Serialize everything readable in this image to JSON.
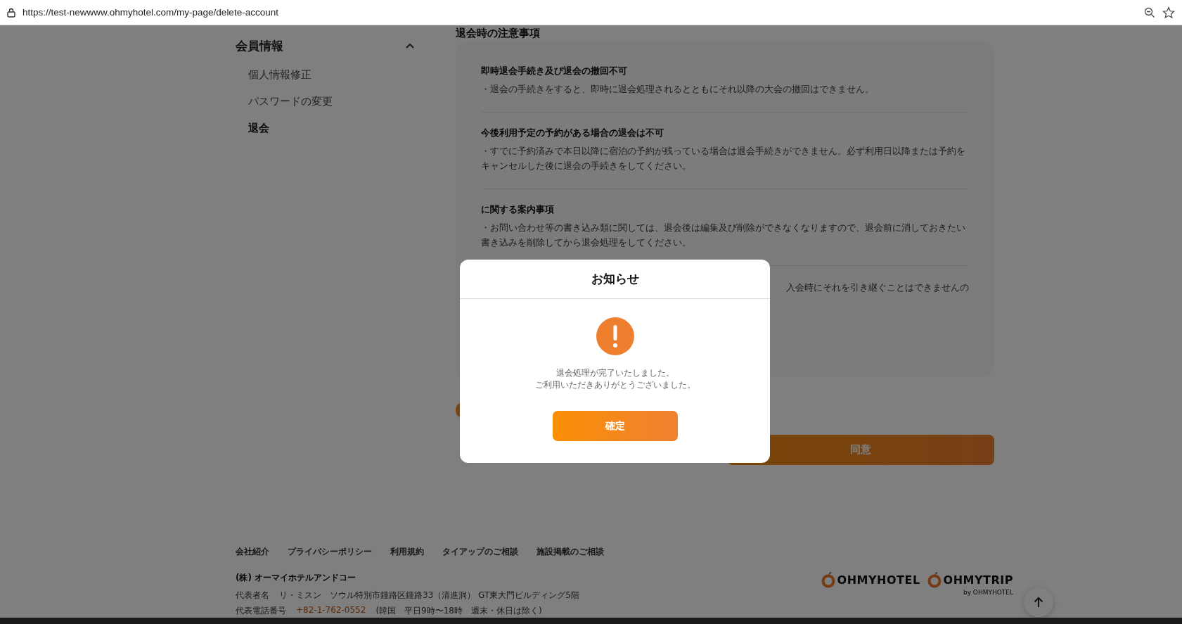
{
  "browser": {
    "url": "https://test-newwww.ohmyhotel.com/my-page/delete-account"
  },
  "sidebar": {
    "title": "会員情報",
    "expanded": true,
    "items": [
      {
        "label": "個人情報修正",
        "selected": false
      },
      {
        "label": "パスワードの変更",
        "selected": false
      },
      {
        "label": "退会",
        "selected": true
      }
    ]
  },
  "section_title": "退会時の注意事項",
  "notices": [
    {
      "title": "即時退会手続き及び退会の撤回不可",
      "body": "・退会の手続きをすると、即時に退会処理されるとともにそれ以降の大会の撤回はできません。"
    },
    {
      "title": "今後利用予定の予約がある場合の退会は不可",
      "body": "・すでに予約済みで本日以降に宿泊の予約が残っている場合は退会手続きができません。必ず利用日以降または予約をキャンセルした後に退会の手続きをしてください。"
    },
    {
      "title": "に関する案内事項",
      "body": "・お問い合わせ等の書き込み類に関しては、退会後は編集及び削除ができなくなりますので、退会前に消しておきたい書き込みを削除してから退会処理をしてください。"
    },
    {
      "body": "入会時にそれを引き継ぐことはできませんの"
    }
  ],
  "agree_button": "同意",
  "footer": {
    "links": [
      "会社紹介",
      "プライバシーポリシー",
      "利用規約",
      "タイアップのご相談",
      "施設掲載のご相談"
    ],
    "company": "(株) オーマイホテルアンドコー",
    "address_label": "代表者名",
    "address": "リ・ミスン　ソウル特別市鍾路区鍾路33（清進洞） GT東大門ビルディング5階",
    "phone_label": "代表電話番号",
    "phone": "+82-1-762-0552",
    "hours": "(韓国　平日9時〜18時　週末・休日は除く)",
    "logos": [
      "OHMYHOTEL",
      "OHMYTRIP"
    ],
    "logo_sub": "by OHMYHOTEL"
  },
  "dialog": {
    "title": "お知らせ",
    "message": [
      "退会処理が完了いたしました。",
      "ご利用いただきありがとうございました。"
    ],
    "confirm": "確定"
  }
}
